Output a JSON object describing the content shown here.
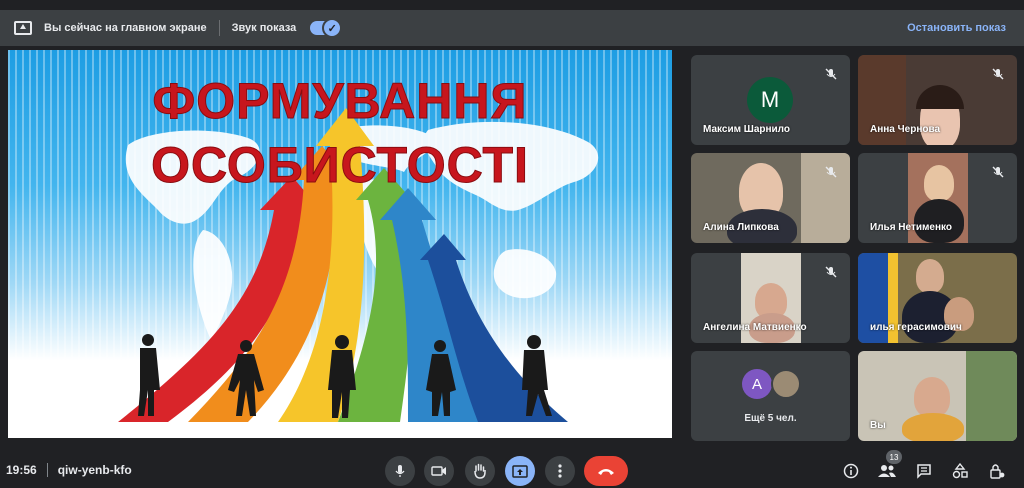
{
  "banner": {
    "presenting_text": "Вы сейчас на главном экране",
    "sound_label": "Звук показа",
    "stop_label": "Остановить показ"
  },
  "slide": {
    "title_line1": "ФОРМУВАННЯ",
    "title_line2": "ОСОБИСТОСТІ"
  },
  "participants": [
    {
      "name": "Максим Шарнило",
      "avatar_letter": "M",
      "avatar_color": "#0b5a3a",
      "muted": true
    },
    {
      "name": "Анна Чернова",
      "muted": true
    },
    {
      "name": "Алина Липкова",
      "muted": true
    },
    {
      "name": "Илья Нетименко",
      "muted": true
    },
    {
      "name": "Ангелина Матвиенко",
      "muted": true
    },
    {
      "name": "илья герасимович",
      "muted": false
    },
    {
      "name": "Вы",
      "muted": false
    }
  ],
  "more": {
    "avatar_letter": "A",
    "label": "Ещё 5 чел."
  },
  "bottom": {
    "time": "19:56",
    "meeting_code": "qiw-yenb-kfo",
    "participant_count": "13"
  },
  "colors": {
    "accent": "#8ab4f8",
    "hangup": "#ea4335",
    "surface": "#3c4043",
    "background": "#202124",
    "slide_title": "#c7161d"
  }
}
